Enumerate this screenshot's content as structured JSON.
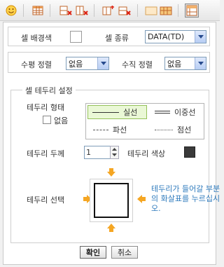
{
  "toolbar": {
    "buttons": [
      "emoticon-icon",
      "table-insert-icon",
      "row-delete-icon",
      "column-delete-icon",
      "cell-merge-icon",
      "cell-split-icon",
      "cell-properties-icon"
    ]
  },
  "cell_options": {
    "bg_label": "셀 배경색",
    "type_label": "셀 종류",
    "type_value": "DATA(TD)",
    "halign_label": "수평 정렬",
    "halign_value": "없음",
    "valign_label": "수직 정렬",
    "valign_value": "없음"
  },
  "border": {
    "group_title": "셀 테두리 설정",
    "style_label": "테두리 형태",
    "none_label": "없음",
    "styles": [
      "실선",
      "이중선",
      "파선",
      "점선"
    ],
    "thickness_label": "테두리 두께",
    "thickness_value": "1",
    "color_label": "테두리 색상",
    "color_value": "#3a3a3a",
    "select_label": "테두리 선택",
    "help_text": "테두리가 들어갈 부분의 화살표를 누르십시오."
  },
  "actions": {
    "confirm": "확인",
    "cancel": "취소"
  },
  "colors": {
    "accent_arrow": "#f5a623",
    "help_text": "#2f7bbd",
    "selected_bg": "#eaf8d6"
  }
}
